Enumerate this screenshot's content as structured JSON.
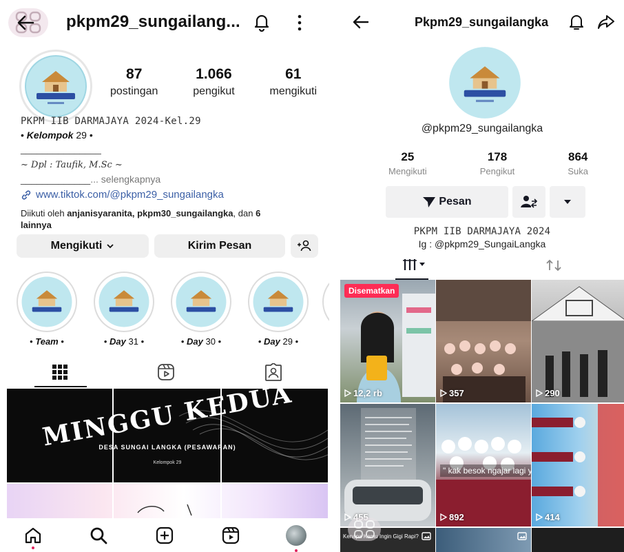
{
  "instagram": {
    "header": {
      "username": "pkpm29_sungailang..."
    },
    "stats": [
      {
        "num": "87",
        "label": "postingan"
      },
      {
        "num": "1.066",
        "label": "pengikut"
      },
      {
        "num": "61",
        "label": "mengikuti"
      }
    ],
    "logo": {
      "title": "PKPM DARMAJAYA 2024",
      "name": "DESA SUNGAILANGKA",
      "group": "KELOMPOK 29"
    },
    "bio": {
      "name": "PKPM IIB DARMAJAYA 2024-Kel.29",
      "kel_prefix": "• ",
      "kel_bold": "Kelompok",
      "kel_suffix": " 29 •",
      "line": "_______________",
      "dpl": "~ Dpl : Taufik, M.Sc ~",
      "more_line": "_____________",
      "more": "... selengkapnya",
      "link": "www.tiktok.com/@pkpm29_sungailangka",
      "followed_prefix": "Diikuti oleh ",
      "followed_names": "anjanisyaranita, pkpm30_sungailangka",
      "followed_mid": ", dan ",
      "followed_count": "6",
      "followed_suffix": " lainnya"
    },
    "actions": {
      "follow": "Mengikuti",
      "message": "Kirim Pesan"
    },
    "highlights": [
      {
        "pre": "• ",
        "bold": "Team",
        "post": " •"
      },
      {
        "pre": "• ",
        "bold": "Day",
        "post": " 31 •"
      },
      {
        "pre": "• ",
        "bold": "Day",
        "post": " 30 •"
      },
      {
        "pre": "• ",
        "bold": "Day",
        "post": " 29 •"
      }
    ],
    "banner": {
      "title": "MINGGU KEDUA",
      "subtitle": "DESA SUNGAI LANGKA (PESAWARAN)",
      "kelompok": "Kelompok 29"
    }
  },
  "tiktok": {
    "header": {
      "title": "Pkpm29_sungailangka"
    },
    "handle": "@pkpm29_sungailangka",
    "stats": [
      {
        "num": "25",
        "label": "Mengikuti"
      },
      {
        "num": "178",
        "label": "Pengikut"
      },
      {
        "num": "864",
        "label": "Suka"
      }
    ],
    "actions": {
      "message": "Pesan"
    },
    "bio": {
      "name": "PKPM IIB DARMAJAYA 2024",
      "ig": "Ig : @pkpm29_SungaiLangka"
    },
    "pinned_label": "Disematkan",
    "videos": [
      {
        "views": "12,2 rb"
      },
      {
        "views": "357"
      },
      {
        "views": "290"
      },
      {
        "views": "455"
      },
      {
        "views": "892",
        "caption": "\" kak besok ngajar lagi y"
      },
      {
        "views": "414"
      }
    ],
    "video_texts": [
      "Kenapa Kamu Ingin Gigi Rapi?"
    ]
  },
  "colors": {
    "link": "#3b5fa6",
    "pinned": "#fe2c55",
    "logo_bg": "#bfe7ef"
  }
}
